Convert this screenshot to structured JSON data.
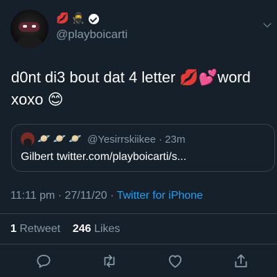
{
  "header": {
    "name_emojis": [
      "💋",
      "🥷"
    ],
    "handle": "@playboicarti"
  },
  "tweet": {
    "line1": "d0nt di3 bout dat 4 letter 💋💕word",
    "line2": "xoxo 😊"
  },
  "quote": {
    "emojis": [
      "🪐",
      "🪐",
      "🪐"
    ],
    "handle_time": "@Yesirrskiikee · 23m",
    "text": "Gilbert twitter.com/playboicarti/s..."
  },
  "meta": {
    "time_date": "11:11 pm · 27/11/20 · ",
    "source": "Twitter for iPhone"
  },
  "stats": {
    "retweets_count": "1",
    "retweets_label": "Retweet",
    "likes_count": "246",
    "likes_label": "Likes"
  },
  "colors": {
    "background": "#15202b",
    "secondary_text": "#8899a6",
    "accent": "#1da1f2",
    "divider": "#38444d"
  },
  "icons": [
    "reply-icon",
    "retweet-icon",
    "like-icon",
    "share-icon",
    "chevron-down-icon",
    "verified-badge-icon"
  ]
}
